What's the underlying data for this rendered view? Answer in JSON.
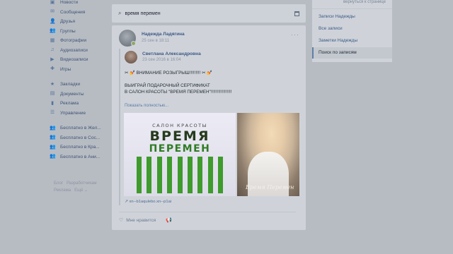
{
  "nav": [
    {
      "icon": "news-icon",
      "glyph": "▣",
      "label": "Новости"
    },
    {
      "icon": "messages-icon",
      "glyph": "✉",
      "label": "Сообщения"
    },
    {
      "icon": "friends-icon",
      "glyph": "👤",
      "label": "Друзья"
    },
    {
      "icon": "groups-icon",
      "glyph": "👥",
      "label": "Группы"
    },
    {
      "icon": "photos-icon",
      "glyph": "▦",
      "label": "Фотографии"
    },
    {
      "icon": "audio-icon",
      "glyph": "♫",
      "label": "Аудиозаписи"
    },
    {
      "icon": "video-icon",
      "glyph": "▶",
      "label": "Видеозаписи"
    },
    {
      "icon": "games-icon",
      "glyph": "✚",
      "label": "Игры"
    }
  ],
  "nav2": [
    {
      "icon": "bookmarks-icon",
      "glyph": "★",
      "label": "Закладки"
    },
    {
      "icon": "documents-icon",
      "glyph": "▤",
      "label": "Документы"
    },
    {
      "icon": "ads-icon",
      "glyph": "▮",
      "label": "Реклама"
    },
    {
      "icon": "manage-icon",
      "glyph": "☰",
      "label": "Управление"
    }
  ],
  "nav3": [
    {
      "icon": "app-icon",
      "glyph": "👥",
      "label": "Бесплатно в Жел..."
    },
    {
      "icon": "app-icon",
      "glyph": "👥",
      "label": "Бесплатно в Сос..."
    },
    {
      "icon": "app-icon",
      "glyph": "👥",
      "label": "Бесплатно в Кра..."
    },
    {
      "icon": "app-icon",
      "glyph": "👥",
      "label": "Бесплатно в Ани..."
    }
  ],
  "footer": {
    "blog": "Блог",
    "devs": "Разработчикам",
    "ads": "Реклама",
    "more": "Ещё ⌄"
  },
  "search": {
    "value": "время перемен"
  },
  "post": {
    "author": "Надежда Ладягина",
    "date": "25 сен в 18:11",
    "more": "···",
    "repost": {
      "author": "Светлана Александровна",
      "date": "23 сен 2016 в 16:04"
    },
    "text_line1": "✂ 💅 ВНИМАНИЕ РОЗЫГРЫШ!!!!!!!!! ✂ 💅",
    "text_line2": "ВЫИГРАЙ ПОДАРОЧНЫЙ СЕРТИФИКАТ",
    "text_line3": "В САЛОН КРАСОТЫ \"ВРЕМЯ ПЕРЕМЕН\"!!!!!!!!!!!!!!!!!",
    "show_full": "Показать полностью...",
    "photo1": {
      "salon": "САЛОН КРАСОТЫ",
      "line1": "ВРЕМЯ",
      "line2": "ПЕРЕМЕН"
    },
    "photo2": {
      "brand": "Время Перемен"
    },
    "link": "xn--b1aqulebo.xn--p1ai",
    "like_label": "Мне нравится"
  },
  "right_menu": {
    "back": "вернуться к странице",
    "items": [
      "Записи Надежды",
      "Все записи",
      "Заметки Надежды"
    ],
    "active": "Поиск по записям"
  }
}
